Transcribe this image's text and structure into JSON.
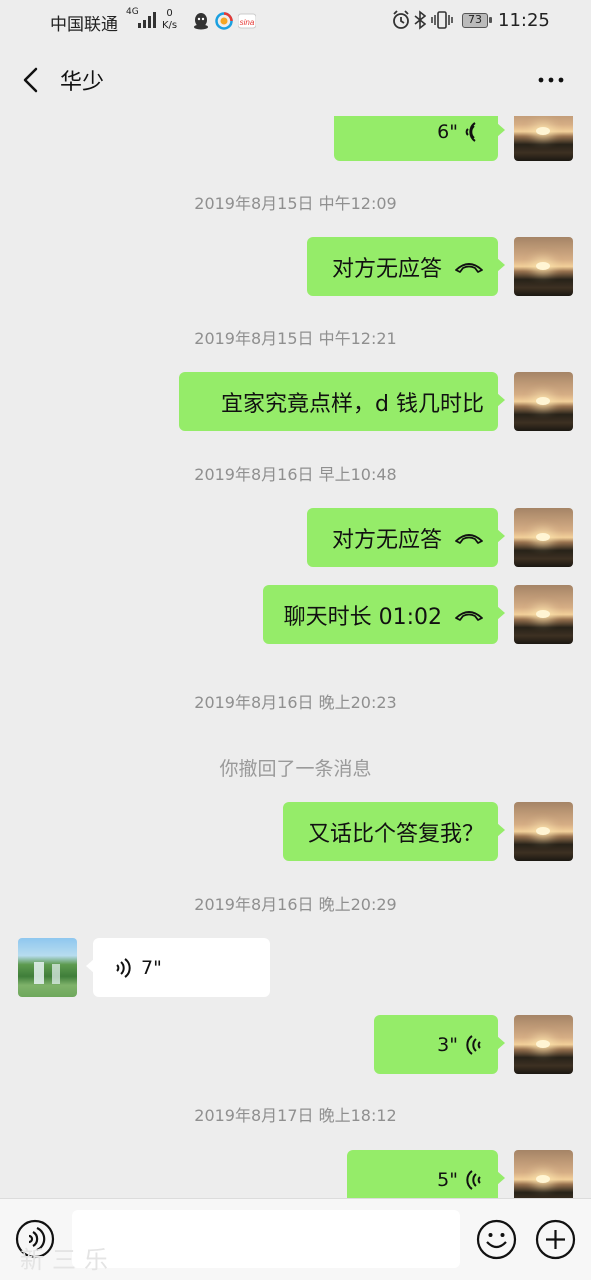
{
  "status_bar": {
    "carrier": "中国联通",
    "network": "4G",
    "speed_value": "0",
    "speed_unit": "K/s",
    "battery": "73",
    "time": "11:25",
    "icons": [
      "signal-icon",
      "qq-icon",
      "browser-icon",
      "weibo-icon",
      "alarm-icon",
      "bluetooth-icon",
      "vibrate-icon",
      "battery-icon"
    ]
  },
  "nav": {
    "title": "华少",
    "more_label": "···"
  },
  "messages": [
    {
      "kind": "voice_out",
      "duration": "6\""
    },
    {
      "kind": "timestamp",
      "text": "2019年8月15日 中午12:09"
    },
    {
      "kind": "call_out",
      "text": "对方无应答"
    },
    {
      "kind": "timestamp",
      "text": "2019年8月15日 中午12:21"
    },
    {
      "kind": "text_out",
      "text": "宜家究竟点样，d 钱几时比"
    },
    {
      "kind": "timestamp",
      "text": "2019年8月16日 早上10:48"
    },
    {
      "kind": "call_out",
      "text": "对方无应答"
    },
    {
      "kind": "call_out",
      "text": "聊天时长 01:02"
    },
    {
      "kind": "timestamp",
      "text": "2019年8月16日 晚上20:23"
    },
    {
      "kind": "recall",
      "text": "你撤回了一条消息"
    },
    {
      "kind": "text_out",
      "text": "又话比个答复我？"
    },
    {
      "kind": "timestamp",
      "text": "2019年8月16日 晚上20:29"
    },
    {
      "kind": "voice_in",
      "duration": "7\""
    },
    {
      "kind": "voice_out",
      "duration": "3\""
    },
    {
      "kind": "timestamp",
      "text": "2019年8月17日 晚上18:12"
    },
    {
      "kind": "voice_out",
      "duration": "5\""
    }
  ],
  "input_bar": {
    "field_value": "",
    "watermark": "新三乐"
  },
  "colors": {
    "background": "#ededed",
    "outgoing_bubble": "#95ec69",
    "incoming_bubble": "#ffffff",
    "timestamp_text": "#8f8f8f"
  }
}
